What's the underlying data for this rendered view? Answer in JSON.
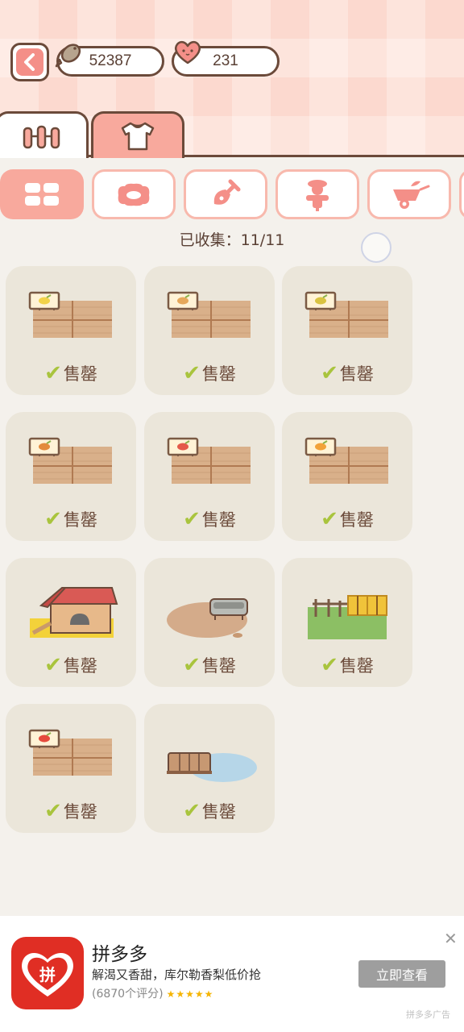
{
  "header": {
    "fish_count": "52387",
    "heart_count": "231"
  },
  "tabs": [
    {
      "icon": "fence-icon",
      "active": false
    },
    {
      "icon": "shirt-icon",
      "active": true
    }
  ],
  "categories": [
    {
      "icon": "grid-icon",
      "active": true
    },
    {
      "icon": "cushion-icon",
      "active": false
    },
    {
      "icon": "shovel-icon",
      "active": false
    },
    {
      "icon": "scarecrow-icon",
      "active": false
    },
    {
      "icon": "wheelbarrow-icon",
      "active": false
    }
  ],
  "collected_text": "已收集：11/11",
  "sold_label": "售罄",
  "items": [
    {
      "art": "plot",
      "seed": "#f2d34a"
    },
    {
      "art": "plot",
      "seed": "#e6a85a"
    },
    {
      "art": "plot",
      "seed": "#d9c341"
    },
    {
      "art": "plot",
      "seed": "#e38b3c"
    },
    {
      "art": "plot",
      "seed": "#e45a4a"
    },
    {
      "art": "plot",
      "seed": "#f2a23a"
    },
    {
      "art": "coop"
    },
    {
      "art": "trough"
    },
    {
      "art": "hay"
    },
    {
      "art": "plot",
      "seed": "#e64b3c"
    },
    {
      "art": "pond"
    }
  ],
  "ad": {
    "title": "拼多多",
    "description": "解渴又香甜，库尔勒香梨低价抢",
    "rating": "(6870个评分)",
    "stars": "★★★★★",
    "button": "立即查看",
    "close": "✕",
    "label": "拼多多广告",
    "logo_text": "拼"
  },
  "colors": {
    "accent_pink": "#f8a99d",
    "outline_brown": "#6b4a3a",
    "check_green": "#a9c43d",
    "card_bg": "#ebe6da",
    "ad_red": "#e02e24"
  }
}
